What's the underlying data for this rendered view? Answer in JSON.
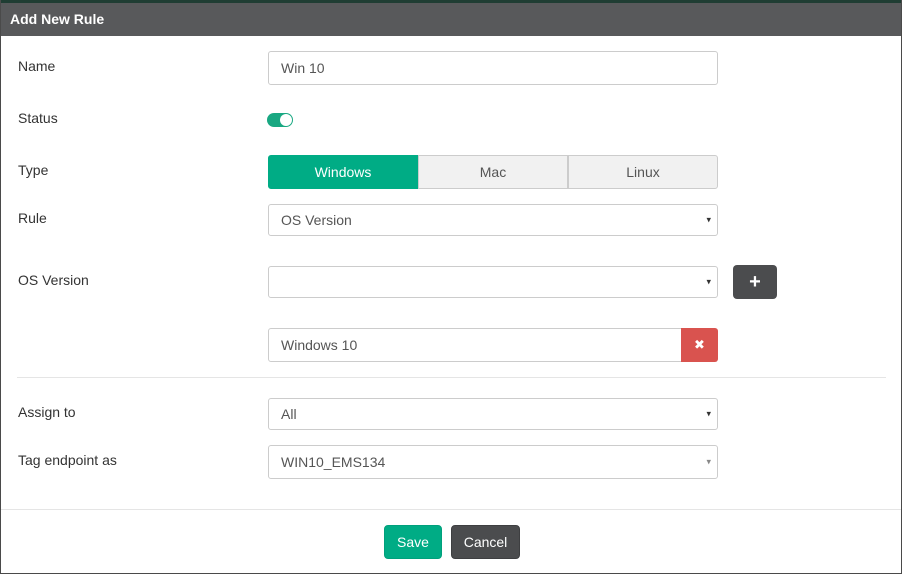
{
  "dialog": {
    "title": "Add New Rule"
  },
  "fields": {
    "name": {
      "label": "Name",
      "value": "Win 10"
    },
    "status": {
      "label": "Status",
      "enabled": true
    },
    "type": {
      "label": "Type",
      "options": [
        "Windows",
        "Mac",
        "Linux"
      ],
      "selected": "Windows"
    },
    "rule": {
      "label": "Rule",
      "value": "OS Version"
    },
    "os_version": {
      "label": "OS Version",
      "value": "",
      "added": [
        "Windows 10"
      ]
    },
    "assign_to": {
      "label": "Assign to",
      "value": "All"
    },
    "tag": {
      "label": "Tag endpoint as",
      "value": "WIN10_EMS134"
    }
  },
  "icons": {
    "caret": "▾",
    "plus": "+",
    "remove": "✖"
  },
  "footer": {
    "save_label": "Save",
    "cancel_label": "Cancel"
  },
  "colors": {
    "header_bg": "#58595b",
    "accent": "#00ac85",
    "danger": "#d9534f",
    "dark_button": "#4b4c4e"
  }
}
